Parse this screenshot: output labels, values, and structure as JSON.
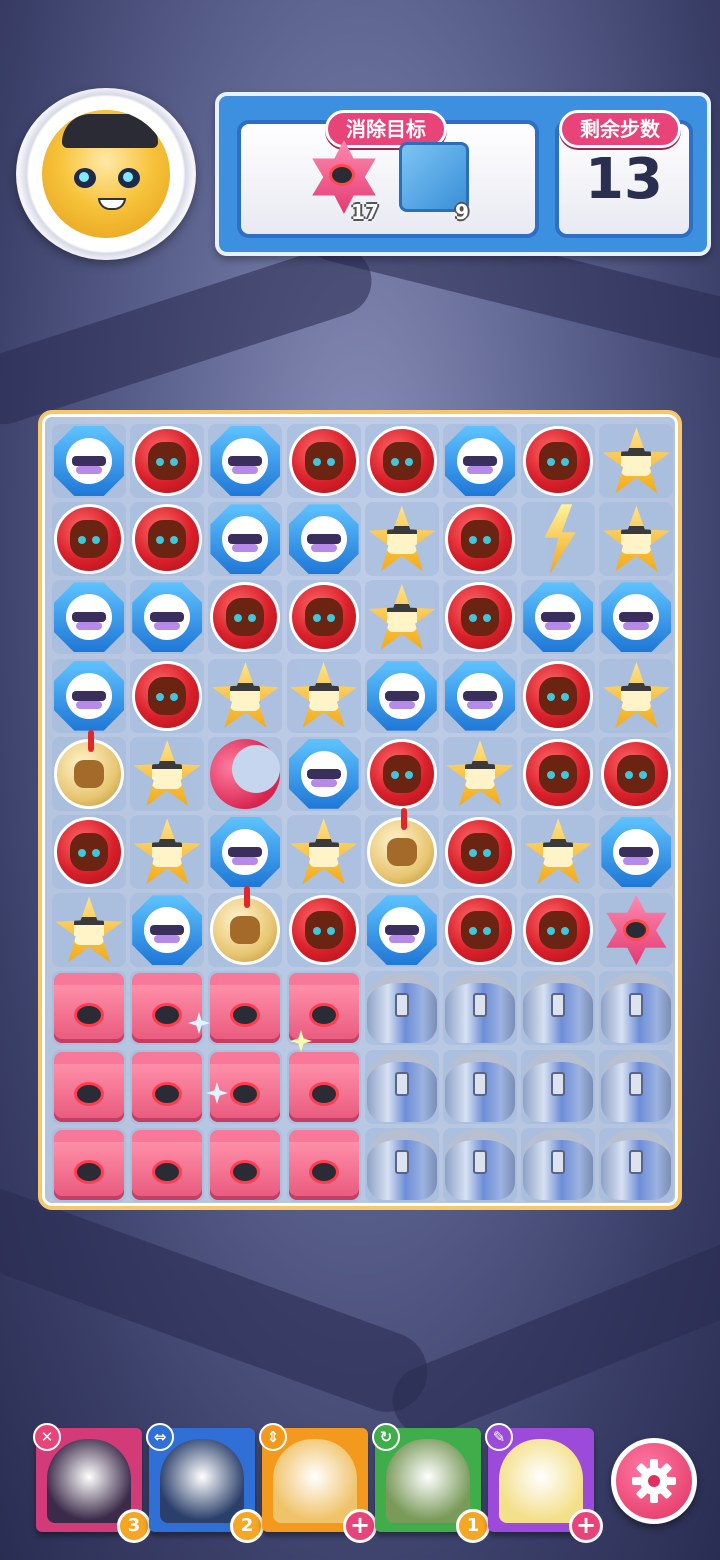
{
  "goal_panel": {
    "goal_label": "消除目标",
    "steps_label": "剩余步数",
    "steps_remaining": "13",
    "goals": [
      {
        "icon": "pink-star-gem-icon",
        "count": "17"
      },
      {
        "icon": "ice-block-icon",
        "count": "9"
      }
    ]
  },
  "board": {
    "cols": 8,
    "rows": 10,
    "grid": [
      [
        "blue",
        "red",
        "blue",
        "red",
        "red",
        "blue",
        "red",
        "gold"
      ],
      [
        "red",
        "red",
        "blue",
        "blue",
        "gold",
        "red",
        "bolt",
        "gold"
      ],
      [
        "blue",
        "blue",
        "red",
        "red",
        "gold",
        "red",
        "blue",
        "blue"
      ],
      [
        "blue",
        "red",
        "gold",
        "gold",
        "blue",
        "blue",
        "red",
        "gold"
      ],
      [
        "coin",
        "gold",
        "moon",
        "blue",
        "red",
        "gold",
        "red",
        "red"
      ],
      [
        "red",
        "gold",
        "blue",
        "gold",
        "coin",
        "red",
        "gold",
        "blue"
      ],
      [
        "gold",
        "blue",
        "coin",
        "red",
        "blue",
        "red",
        "red",
        "pinkstar"
      ],
      [
        "box",
        "box",
        "box",
        "box",
        "urn",
        "urn",
        "urn",
        "urn"
      ],
      [
        "box",
        "box",
        "box",
        "box",
        "urn",
        "urn",
        "urn",
        "urn"
      ],
      [
        "box",
        "box",
        "box",
        "box",
        "urn",
        "urn",
        "urn",
        "urn"
      ]
    ]
  },
  "heroes": [
    {
      "name": "hero-1",
      "badge": "✕",
      "badge_color": "#e8447a",
      "frame": "#d23a78",
      "counter": "3",
      "plus": false
    },
    {
      "name": "hero-2",
      "badge": "⇔",
      "badge_color": "#2f6fd6",
      "frame": "#2f6fd6",
      "counter": "2",
      "plus": false
    },
    {
      "name": "hero-3",
      "badge": "⇕",
      "badge_color": "#f39a1e",
      "frame": "#f39a1e",
      "counter": "+",
      "plus": true
    },
    {
      "name": "hero-4",
      "badge": "↻",
      "badge_color": "#3fae4a",
      "frame": "#3fae4a",
      "counter": "1",
      "plus": false
    },
    {
      "name": "hero-5",
      "badge": "✎",
      "badge_color": "#9b4ad9",
      "frame": "#9b4ad9",
      "counter": "+",
      "plus": true
    }
  ],
  "settings_icon": "gear-icon"
}
